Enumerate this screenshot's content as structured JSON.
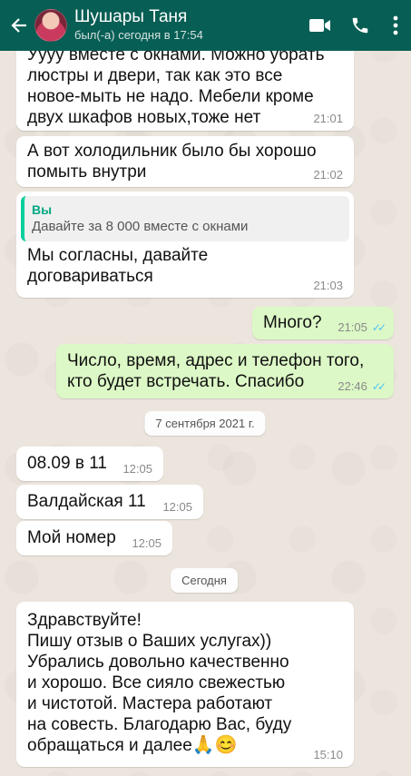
{
  "header": {
    "back_glyph": "←",
    "contact_name": "Шушары Таня",
    "last_seen": "был(-а) сегодня в 17:54",
    "icons": [
      "back-arrow-icon",
      "video-call-icon",
      "phone-call-icon",
      "more-options-icon"
    ]
  },
  "colors": {
    "header": "#075e54",
    "incoming": "#ffffff",
    "outgoing": "#dcf8c6",
    "read_ticks": "#4fc3f7",
    "chat_bg": "#ece5dd"
  },
  "messages": {
    "m1": {
      "text": "Уууу вместе с окнами. Можно убрать\nлюстры и двери, так как это все\nновое-мыть не надо. Мебели кроме\nдвух шкафов новых,тоже нет",
      "time": "21:01"
    },
    "m2": {
      "text": "А вот холодильник было бы хорошо\nпомыть внутри",
      "time": "21:02"
    },
    "m3": {
      "quote_author": "Вы",
      "quote_text": "Давайте за 8 000 вместе с окнами",
      "text": "Мы согласны, давайте\nдоговариваться",
      "time": "21:03"
    },
    "m4": {
      "text": "Много?",
      "time": "21:05"
    },
    "m5": {
      "text": "Число, время, адрес и телефон того,\nкто будет встречать. Спасибо",
      "time": "22:46"
    },
    "date1": "7 сентября 2021 г.",
    "m6": {
      "text": "08.09 в 11",
      "time": "12:05"
    },
    "m7": {
      "text": "Валдайская 11",
      "time": "12:05"
    },
    "m8": {
      "text": "Мой номер",
      "time": "12:05"
    },
    "date2": "Сегодня",
    "m9": {
      "text": "Здравствуйте!\nПишу отзыв о Ваших услугах))\nУбрались довольно качественно\nи хорошо. Все сияло свежестью\nи чистотой. Мастера работают\nна совесть. Благодарю Вас, буду\nобращаться и далее",
      "emoji": "🙏😊",
      "time": "15:10"
    }
  }
}
